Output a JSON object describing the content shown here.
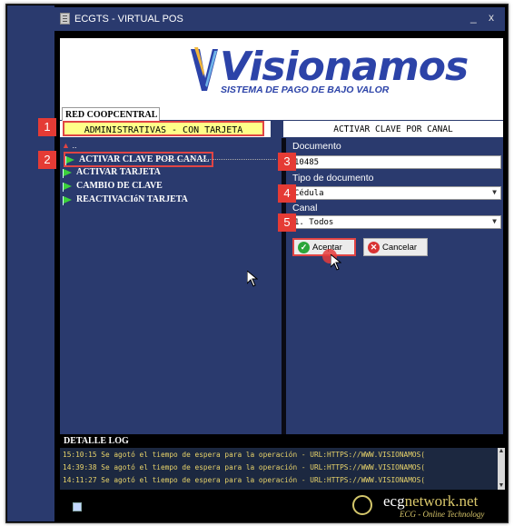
{
  "window": {
    "title": "ECGTS - VIRTUAL POS",
    "minimize_glyph": "_",
    "close_glyph": "x",
    "icon": "app-icon"
  },
  "logo": {
    "brand": "Visionamos",
    "tagline": "SISTEMA DE PAGO DE BAJO VALOR",
    "color": "#2c43a8"
  },
  "tab": {
    "label": "RED COOPCENTRAL"
  },
  "panel": {
    "left_header": "ADMINISTRATIVAS - CON TARJETA",
    "right_header": "ACTIVAR CLAVE POR CANAL"
  },
  "tree": {
    "root": "..",
    "items": [
      {
        "label": "ACTIVAR CLAVE POR CANAL",
        "selected": true
      },
      {
        "label": "ACTIVAR TARJETA",
        "selected": false
      },
      {
        "label": "CAMBIO DE CLAVE",
        "selected": false
      },
      {
        "label": "REACTIVACIóN TARJETA",
        "selected": false
      }
    ]
  },
  "form": {
    "documento_label": "Documento",
    "documento_value": "10485",
    "tipo_label": "Tipo de documento",
    "tipo_value": "Cédula",
    "canal_label": "Canal",
    "canal_value": "1. Todos",
    "accept_label": "Aceptar",
    "cancel_label": "Cancelar"
  },
  "badges": [
    "1",
    "2",
    "3",
    "4",
    "5"
  ],
  "log": {
    "title": "DETALLE LOG",
    "lines": [
      "15:10:15 Se agotó el tiempo de espera para la operación - URL:HTTPS://WWW.VISIONAMOS(",
      "14:39:38 Se agotó el tiempo de espera para la operación - URL:HTTPS://WWW.VISIONAMOS(",
      "14:11:27 Se agotó el tiempo de espera para la operación - URL:HTTPS://WWW.VISIONAMOS("
    ]
  },
  "footer": {
    "brand_prefix": "ecg",
    "brand_suffix": "network.net",
    "tagline": "ECG - Online Technology"
  },
  "colors": {
    "panel_bg": "#2a3a6e",
    "badge_red": "#e53b35",
    "highlight_yellow": "#ffff88",
    "log_text": "#e8d36a"
  }
}
